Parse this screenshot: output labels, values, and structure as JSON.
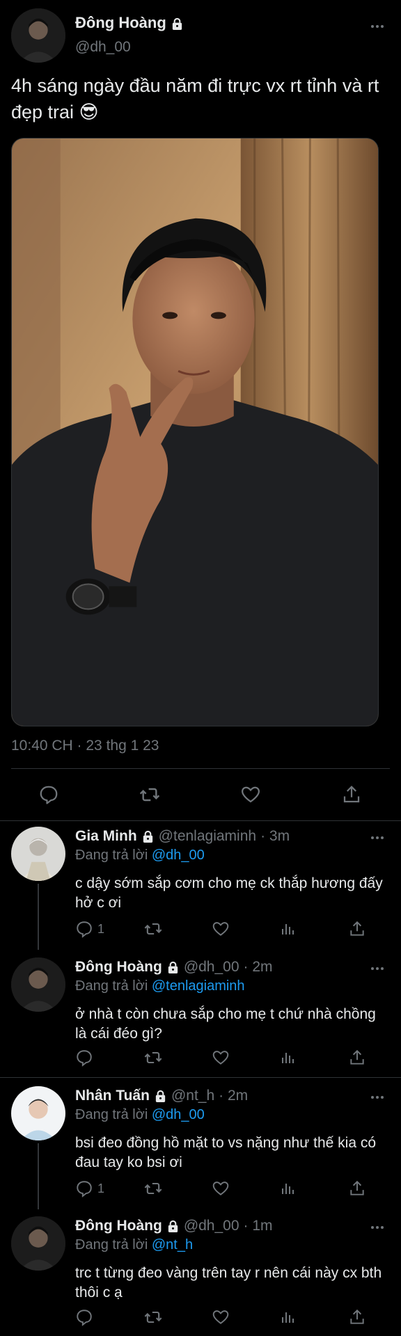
{
  "main_tweet": {
    "author_name": "Đông Hoàng",
    "handle": "@dh_00",
    "text": "4h sáng ngày đầu năm đi trực vx rt tỉnh và rt đẹp trai 😎",
    "timestamp": "10:40 CH · 23 thg 1 23",
    "actions": [
      "reply-icon",
      "retweet-icon",
      "like-icon",
      "share-icon"
    ]
  },
  "replies": [
    {
      "author_name": "Gia Minh",
      "handle": "@tenlagiaminh",
      "time": "· 3m",
      "replying_prefix": "Đang trả lời",
      "replying_to": "@dh_00",
      "text": "c dậy sớm sắp cơm cho mẹ ck thắp hương đấy hở c ơi",
      "reply_count": "1",
      "protected": true
    },
    {
      "author_name": "Đông Hoàng",
      "handle": "@dh_00",
      "time": "· 2m",
      "replying_prefix": "Đang trả lời",
      "replying_to": "@tenlagiaminh",
      "text": "ở nhà t còn chưa sắp cho mẹ t chứ nhà chồng là cái đéo gì?",
      "reply_count": "",
      "protected": true
    },
    {
      "author_name": "Nhân Tuấn",
      "handle": "@nt_h",
      "time": "· 2m",
      "replying_prefix": "Đang trả lời",
      "replying_to": "@dh_00",
      "text": "bsi đeo đồng hồ mặt to vs nặng như thế kia có đau tay ko bsi ơi",
      "reply_count": "1",
      "protected": true
    },
    {
      "author_name": "Đông Hoàng",
      "handle": "@dh_00",
      "time": "· 1m",
      "replying_prefix": "Đang trả lời",
      "replying_to": "@nt_h",
      "text": "trc t từng đeo vàng trên tay r nên cái này cx bth thôi c ạ",
      "reply_count": "",
      "protected": true
    }
  ],
  "colors": {
    "background": "#000000",
    "text": "#e7e9ea",
    "secondary": "#71767b",
    "link": "#1d9bf0",
    "divider": "#2f3336"
  }
}
